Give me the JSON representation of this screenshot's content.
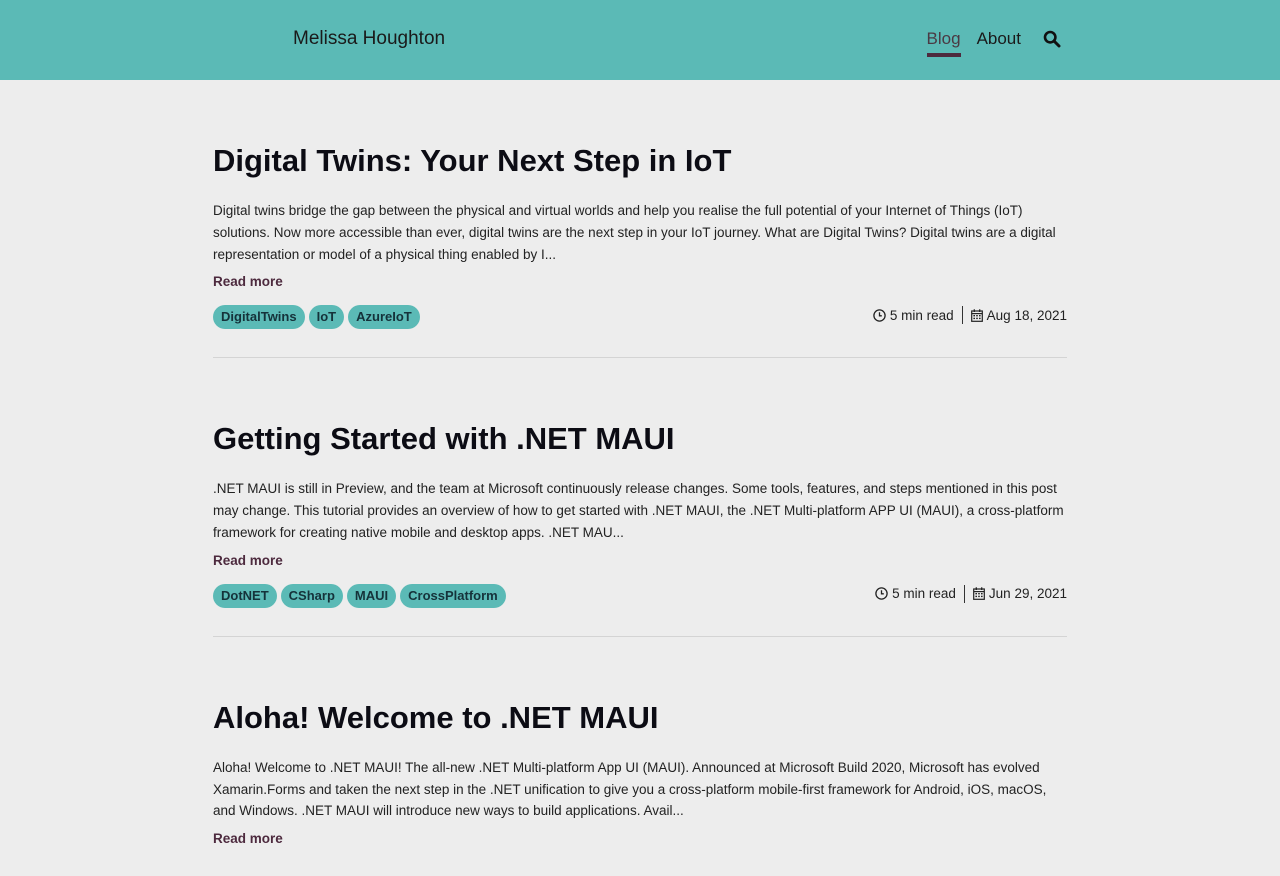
{
  "header": {
    "site_title": "Melissa Houghton",
    "nav": [
      {
        "label": "Blog",
        "active": true
      },
      {
        "label": "About",
        "active": false
      }
    ],
    "search_icon": "search-icon",
    "colors": {
      "header_bg": "#5bbab6",
      "accent": "#4d2a3e"
    }
  },
  "posts": [
    {
      "title": "Digital Twins: Your Next Step in IoT",
      "excerpt": "Digital twins bridge the gap between the physical and virtual worlds and help you realise the full potential of your Internet of Things (IoT) solutions. Now more accessible than ever, digital twins are the next step in your IoT journey. What are Digital Twins? Digital twins are a digital representation or model of a physical thing enabled by I...",
      "read_more": "Read more",
      "tags": [
        "DigitalTwins",
        "IoT",
        "AzureIoT"
      ],
      "read_time": "5 min read",
      "date": "Aug 18, 2021"
    },
    {
      "title": "Getting Started with .NET MAUI",
      "excerpt": ".NET MAUI is still in Preview, and the team at Microsoft continuously release changes. Some tools, features, and steps mentioned in this post may change. This tutorial provides an overview of how to get started with .NET MAUI, the .NET Multi-platform APP UI (MAUI), a cross-platform framework for creating native mobile and desktop apps. .NET MAU...",
      "read_more": "Read more",
      "tags": [
        "DotNET",
        "CSharp",
        "MAUI",
        "CrossPlatform"
      ],
      "read_time": "5 min read",
      "date": "Jun 29, 2021"
    },
    {
      "title": "Aloha! Welcome to .NET MAUI",
      "excerpt": "Aloha! Welcome to .NET MAUI! The all-new .NET Multi-platform App UI (MAUI). Announced at Microsoft Build 2020, Microsoft has evolved Xamarin.Forms and taken the next step in the .NET unification to give you a cross-platform mobile-first framework for Android, iOS, macOS, and Windows. .NET MAUI will introduce new ways to build applications. Avail...",
      "read_more": "Read more",
      "tags": [],
      "read_time": "",
      "date": ""
    }
  ]
}
